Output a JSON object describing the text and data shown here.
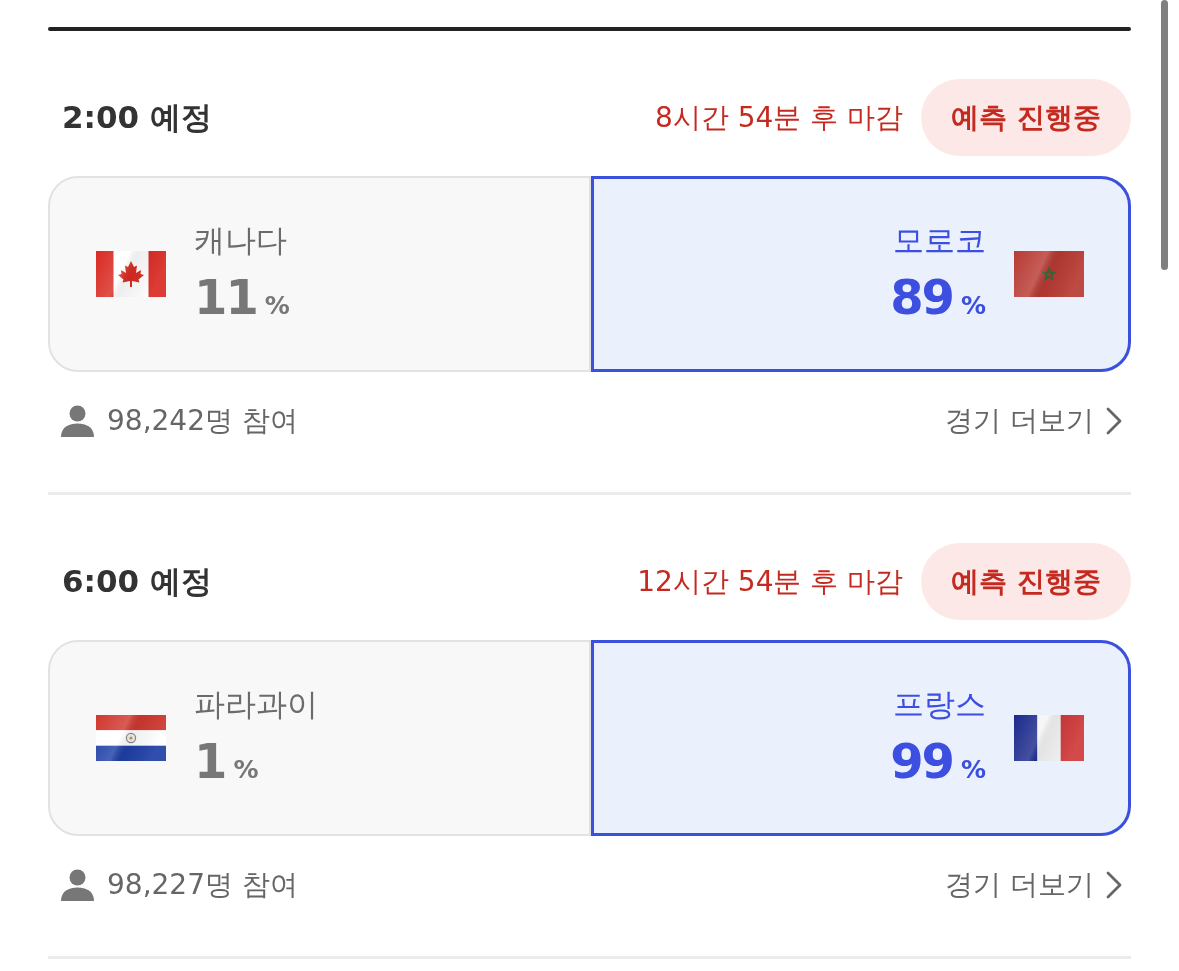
{
  "matches": [
    {
      "time": "2:00 예정",
      "deadline": "8시간 54분 후 마감",
      "status": "예측 진행중",
      "teams": [
        {
          "name": "캐나다",
          "percent": "11",
          "unit": "%",
          "kind": "canada",
          "selected": false
        },
        {
          "name": "모로코",
          "percent": "89",
          "unit": "%",
          "kind": "morocco",
          "selected": true
        }
      ],
      "participants": "98,242명 참여",
      "more_link": "경기 더보기"
    },
    {
      "time": "6:00 예정",
      "deadline": "12시간 54분 후 마감",
      "status": "예측 진행중",
      "teams": [
        {
          "name": "파라과이",
          "percent": "1",
          "unit": "%",
          "kind": "paraguay",
          "selected": false
        },
        {
          "name": "프랑스",
          "percent": "99",
          "unit": "%",
          "kind": "france",
          "selected": true
        }
      ],
      "participants": "98,227명 참여",
      "more_link": "경기 더보기"
    }
  ]
}
